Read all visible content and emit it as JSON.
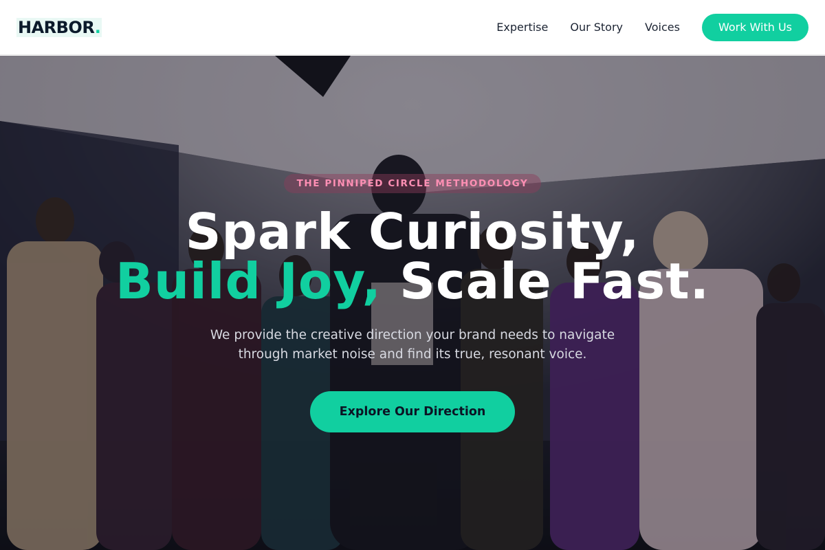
{
  "brand": {
    "name": "HARBOR",
    "dot": ".",
    "accent_color": "#11cfa0"
  },
  "nav": {
    "links": [
      {
        "label": "Expertise"
      },
      {
        "label": "Our Story"
      },
      {
        "label": "Voices"
      }
    ],
    "cta_label": "Work With Us"
  },
  "hero": {
    "badge": "THE PINNIPED CIRCLE METHODOLOGY",
    "headline_line1": "Spark Curiosity,",
    "headline_accent": "Build Joy,",
    "headline_line2_rest": " Scale Fast.",
    "subtitle": "We provide the creative direction your brand needs to navigate through market noise and find its true, resonant voice.",
    "cta_label": "Explore Our Direction",
    "background": "hero-photo-group-of-people"
  }
}
